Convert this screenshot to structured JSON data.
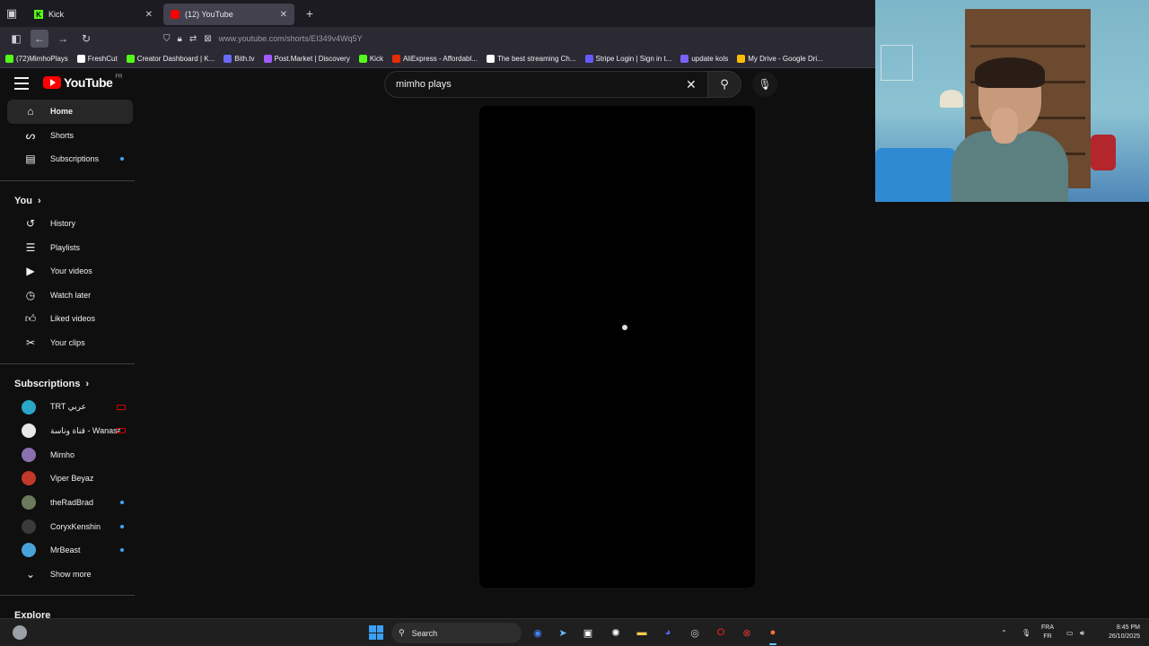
{
  "browser": {
    "tabs": [
      {
        "label": "Kick",
        "favicon_color": "#53fc18",
        "favicon_glyph": "K",
        "active": false
      },
      {
        "label": "(12) YouTube",
        "favicon_color": "#ff0000",
        "favicon_glyph": "",
        "active": true
      }
    ],
    "url": "www.youtube.com/shorts/EI349v4Wq5Y",
    "bookmarks": [
      {
        "label": "(72)MimhoPlays",
        "icon": "kick-icon",
        "color": "#53fc18"
      },
      {
        "label": "FreshCut",
        "icon": "heart-icon",
        "color": "#ffffff"
      },
      {
        "label": "Creator Dashboard | K...",
        "icon": "kick-icon",
        "color": "#53fc18"
      },
      {
        "label": "Bith.tv",
        "icon": "bith-icon",
        "color": "#6a6aff"
      },
      {
        "label": "Post.Market | Discovery",
        "icon": "postmarket-icon",
        "color": "#a259ff"
      },
      {
        "label": "Kick",
        "icon": "kick-icon",
        "color": "#53fc18"
      },
      {
        "label": "AliExpress - Affordabl...",
        "icon": "aliexpress-icon",
        "color": "#e62e04"
      },
      {
        "label": "The best streaming Ch...",
        "icon": "diamond-icon",
        "color": "#ffffff"
      },
      {
        "label": "Stripe Login | Sign in t...",
        "icon": "stripe-icon",
        "color": "#635bff"
      },
      {
        "label": "update kols",
        "icon": "doc-icon",
        "color": "#7b61ff"
      },
      {
        "label": "My Drive - Google Dri...",
        "icon": "drive-icon",
        "color": "#fbbc04"
      }
    ]
  },
  "youtube": {
    "logo_text": "YouTube",
    "country_code": "FR",
    "search_value": "mimho plays",
    "sidebar": {
      "main": [
        {
          "label": "Home",
          "icon": "home-icon",
          "active": true,
          "dot": false
        },
        {
          "label": "Shorts",
          "icon": "shorts-icon",
          "active": false,
          "dot": false
        },
        {
          "label": "Subscriptions",
          "icon": "subscriptions-icon",
          "active": false,
          "dot": true
        }
      ],
      "you_heading": "You",
      "you": [
        {
          "label": "History",
          "icon": "history-icon"
        },
        {
          "label": "Playlists",
          "icon": "playlists-icon"
        },
        {
          "label": "Your videos",
          "icon": "your-videos-icon"
        },
        {
          "label": "Watch later",
          "icon": "watch-later-icon"
        },
        {
          "label": "Liked videos",
          "icon": "liked-videos-icon"
        },
        {
          "label": "Your clips",
          "icon": "clips-icon"
        }
      ],
      "subscriptions_heading": "Subscriptions",
      "subscriptions": [
        {
          "label": "TRT عربي",
          "avatar_color": "#2aa7c7",
          "indicator": "live"
        },
        {
          "label": "قناة وناسة - Wanasa...",
          "avatar_color": "#e8e8e8",
          "indicator": "live"
        },
        {
          "label": "Mimho",
          "avatar_color": "#8b6fb0",
          "indicator": "none"
        },
        {
          "label": "Viper Beyaz",
          "avatar_color": "#c0392b",
          "indicator": "none"
        },
        {
          "label": "theRadBrad",
          "avatar_color": "#6a7a5a",
          "indicator": "dot"
        },
        {
          "label": "CoryxKenshin",
          "avatar_color": "#3a3a3a",
          "indicator": "dot"
        },
        {
          "label": "MrBeast",
          "avatar_color": "#4aa3d8",
          "indicator": "dot"
        }
      ],
      "show_more": "Show more",
      "explore_heading": "Explore"
    }
  },
  "taskbar": {
    "search_label": "Search",
    "apps": [
      {
        "name": "chrome-icon",
        "color": "#4285f4",
        "glyph": "◉"
      },
      {
        "name": "steam-icon",
        "color": "#66c0f4",
        "glyph": "➤"
      },
      {
        "name": "capture-icon",
        "color": "#ffffff",
        "glyph": "▣"
      },
      {
        "name": "chatgpt-icon",
        "color": "#ffffff",
        "glyph": "✺"
      },
      {
        "name": "file-explorer-icon",
        "color": "#f2c94c",
        "glyph": "▬"
      },
      {
        "name": "discord-icon",
        "color": "#5865f2",
        "glyph": "◕"
      },
      {
        "name": "app-icon",
        "color": "#cccccc",
        "glyph": "◎"
      },
      {
        "name": "opera-icon",
        "color": "#ff1b2d",
        "glyph": "O"
      },
      {
        "name": "redapp-icon",
        "color": "#e53935",
        "glyph": "⊗"
      },
      {
        "name": "firefox-icon",
        "color": "#ff7139",
        "glyph": "●"
      }
    ],
    "language": [
      "FRA",
      "FR"
    ],
    "time": "8:45 PM",
    "date": "26/10/2025"
  }
}
